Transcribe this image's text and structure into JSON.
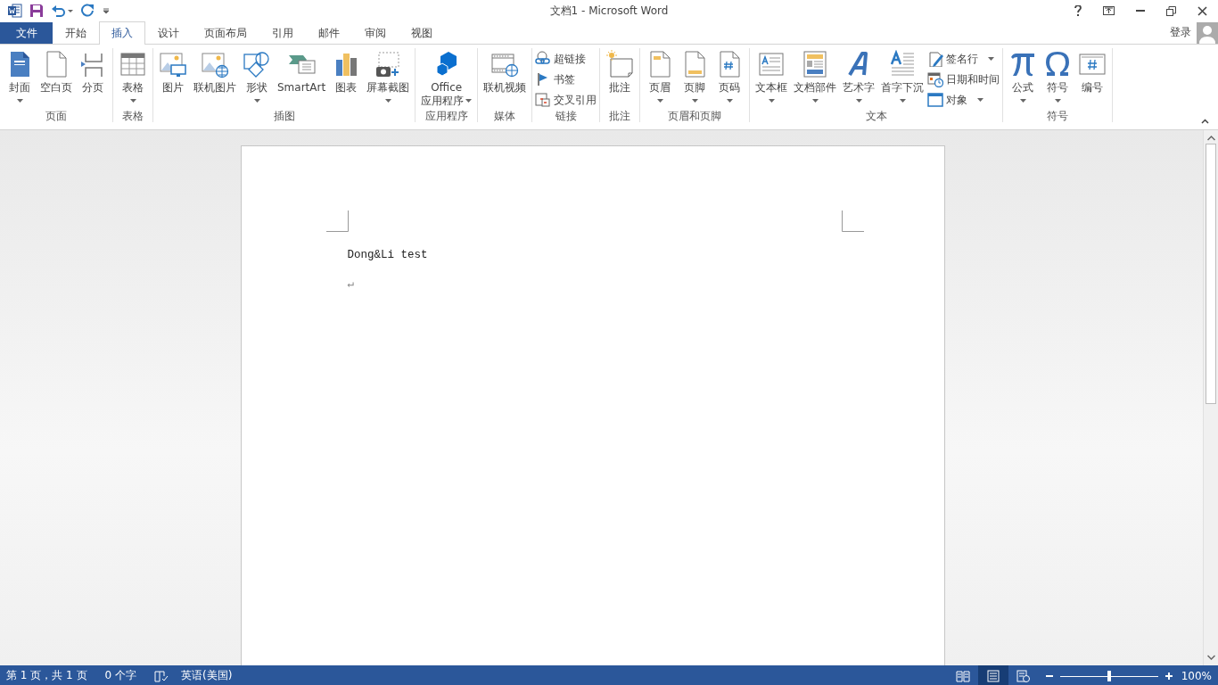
{
  "title_bar": {
    "title": "文档1 - Microsoft Word"
  },
  "tabs": [
    {
      "label": "文件",
      "kind": "file",
      "selected": false
    },
    {
      "label": "开始",
      "kind": "tab",
      "selected": false
    },
    {
      "label": "插入",
      "kind": "tab",
      "selected": true
    },
    {
      "label": "设计",
      "kind": "tab",
      "selected": false
    },
    {
      "label": "页面布局",
      "kind": "tab",
      "selected": false
    },
    {
      "label": "引用",
      "kind": "tab",
      "selected": false
    },
    {
      "label": "邮件",
      "kind": "tab",
      "selected": false
    },
    {
      "label": "审阅",
      "kind": "tab",
      "selected": false
    },
    {
      "label": "视图",
      "kind": "tab",
      "selected": false
    }
  ],
  "account": {
    "sign_in": "登录"
  },
  "ribbon": {
    "groups": [
      {
        "label": "页面",
        "items": [
          {
            "label": "封面",
            "kind": "large",
            "dropdown": true
          },
          {
            "label": "空白页",
            "kind": "large",
            "dropdown": false
          },
          {
            "label": "分页",
            "kind": "large",
            "dropdown": false
          }
        ]
      },
      {
        "label": "表格",
        "items": [
          {
            "label": "表格",
            "kind": "large",
            "dropdown": true
          }
        ]
      },
      {
        "label": "插图",
        "items": [
          {
            "label": "图片",
            "kind": "large",
            "dropdown": false
          },
          {
            "label": "联机图片",
            "kind": "large",
            "dropdown": false
          },
          {
            "label": "形状",
            "kind": "large",
            "dropdown": true
          },
          {
            "label": "SmartArt",
            "kind": "large",
            "dropdown": false
          },
          {
            "label": "图表",
            "kind": "large",
            "dropdown": false
          },
          {
            "label": "屏幕截图",
            "kind": "large",
            "dropdown": true
          }
        ]
      },
      {
        "label": "应用程序",
        "items": [
          {
            "label": "Office 应用程序",
            "kind": "tall",
            "dropdown": true
          }
        ]
      },
      {
        "label": "媒体",
        "items": [
          {
            "label": "联机视频",
            "kind": "large",
            "dropdown": false
          }
        ]
      },
      {
        "label": "链接",
        "items": [
          {
            "label": "超链接",
            "kind": "small",
            "dropdown": false
          },
          {
            "label": "书签",
            "kind": "small",
            "dropdown": false
          },
          {
            "label": "交叉引用",
            "kind": "small",
            "dropdown": false
          }
        ]
      },
      {
        "label": "批注",
        "items": [
          {
            "label": "批注",
            "kind": "large",
            "dropdown": false
          }
        ]
      },
      {
        "label": "页眉和页脚",
        "items": [
          {
            "label": "页眉",
            "kind": "large",
            "dropdown": true
          },
          {
            "label": "页脚",
            "kind": "large",
            "dropdown": true
          },
          {
            "label": "页码",
            "kind": "large",
            "dropdown": true
          }
        ]
      },
      {
        "label": "文本",
        "items": [
          {
            "label": "文本框",
            "kind": "large",
            "dropdown": true
          },
          {
            "label": "文档部件",
            "kind": "large",
            "dropdown": true
          },
          {
            "label": "艺术字",
            "kind": "large",
            "dropdown": true
          },
          {
            "label": "首字下沉",
            "kind": "large",
            "dropdown": true
          },
          {
            "label": "签名行",
            "kind": "small",
            "dropdown": true
          },
          {
            "label": "日期和时间",
            "kind": "small",
            "dropdown": false
          },
          {
            "label": "对象",
            "kind": "small",
            "dropdown": true
          }
        ]
      },
      {
        "label": "符号",
        "items": [
          {
            "label": "公式",
            "kind": "large",
            "dropdown": true
          },
          {
            "label": "符号",
            "kind": "large",
            "dropdown": true
          },
          {
            "label": "编号",
            "kind": "large",
            "dropdown": false
          }
        ]
      }
    ]
  },
  "document": {
    "lines": [
      "Dong&Li test",
      "↵"
    ]
  },
  "status_bar": {
    "page": "第 1 页，共 1 页",
    "words": "0 个字",
    "language": "英语(美国)",
    "views": [
      {
        "kind": "read",
        "selected": false
      },
      {
        "kind": "print",
        "selected": true
      },
      {
        "kind": "web",
        "selected": false
      }
    ],
    "zoom": {
      "level": 0.5,
      "reading": "100%"
    }
  }
}
